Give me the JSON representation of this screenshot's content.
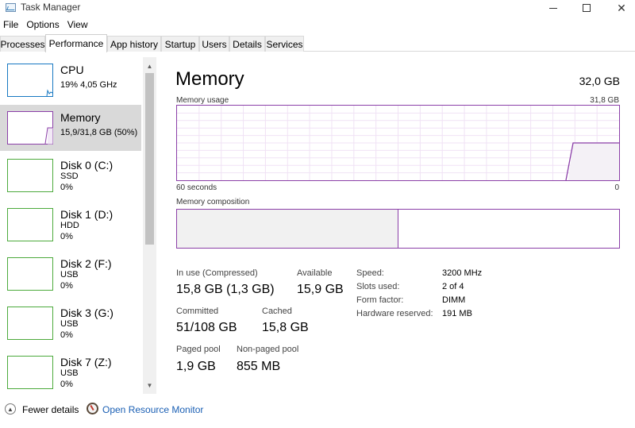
{
  "window": {
    "title": "Task Manager"
  },
  "menu": {
    "items": [
      "File",
      "Options",
      "View"
    ]
  },
  "tabs": [
    "Processes",
    "Performance",
    "App history",
    "Startup",
    "Users",
    "Details",
    "Services"
  ],
  "active_tab": "Performance",
  "sidebar": {
    "items": [
      {
        "name": "CPU",
        "line1": "19% 4,05 GHz",
        "line2": "",
        "color": "#1778c2",
        "selected": false,
        "icon": "cpu-graph"
      },
      {
        "name": "Memory",
        "line1": "15,9/31,8 GB (50%)",
        "line2": "",
        "color": "#8b3fa8",
        "selected": true,
        "icon": "memory-graph"
      },
      {
        "name": "Disk 0 (C:)",
        "line1": "SSD",
        "line2": "0%",
        "color": "#4caa3c",
        "selected": false,
        "icon": "disk-graph"
      },
      {
        "name": "Disk 1 (D:)",
        "line1": "HDD",
        "line2": "0%",
        "color": "#4caa3c",
        "selected": false,
        "icon": "disk-graph"
      },
      {
        "name": "Disk 2 (F:)",
        "line1": "USB",
        "line2": "0%",
        "color": "#4caa3c",
        "selected": false,
        "icon": "disk-graph"
      },
      {
        "name": "Disk 3 (G:)",
        "line1": "USB",
        "line2": "0%",
        "color": "#4caa3c",
        "selected": false,
        "icon": "disk-graph"
      },
      {
        "name": "Disk 7 (Z:)",
        "line1": "USB",
        "line2": "0%",
        "color": "#4caa3c",
        "selected": false,
        "icon": "disk-graph"
      }
    ]
  },
  "main": {
    "title": "Memory",
    "total": "32,0 GB",
    "usage_label": "Memory usage",
    "usage_max": "31,8 GB",
    "time_left": "60 seconds",
    "time_right": "0",
    "composition_label": "Memory composition",
    "in_use_fraction": 0.5,
    "accent": "#8b3fa8",
    "stats": {
      "in_use_label": "In use (Compressed)",
      "in_use_value": "15,8 GB (1,3 GB)",
      "available_label": "Available",
      "available_value": "15,9 GB",
      "committed_label": "Committed",
      "committed_value": "51/108 GB",
      "cached_label": "Cached",
      "cached_value": "15,8 GB",
      "paged_label": "Paged pool",
      "paged_value": "1,9 GB",
      "nonpaged_label": "Non-paged pool",
      "nonpaged_value": "855 MB"
    },
    "details": [
      {
        "label": "Speed:",
        "value": "3200 MHz"
      },
      {
        "label": "Slots used:",
        "value": "2 of 4"
      },
      {
        "label": "Form factor:",
        "value": "DIMM"
      },
      {
        "label": "Hardware reserved:",
        "value": "191 MB"
      }
    ]
  },
  "footer": {
    "fewer_details": "Fewer details",
    "open_monitor": "Open Resource Monitor"
  }
}
